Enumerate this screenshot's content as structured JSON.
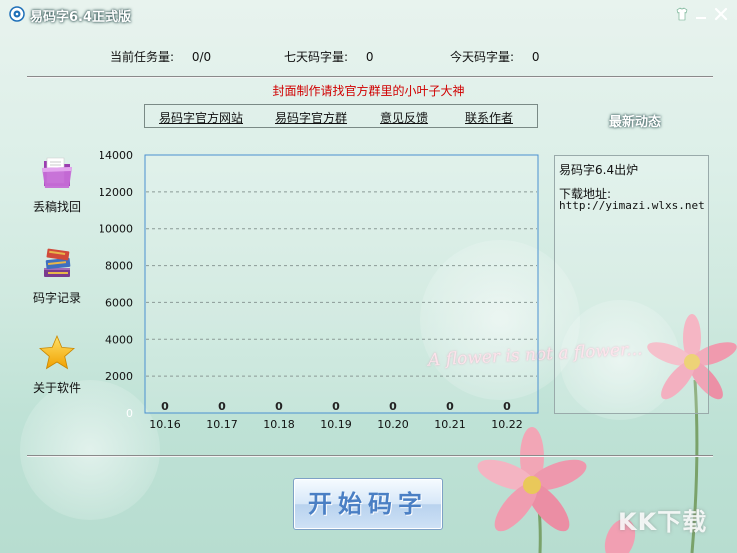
{
  "window": {
    "title": "易码字6.4正式版"
  },
  "stats": {
    "current_tasks_label": "当前任务量:",
    "current_tasks_value": "0/0",
    "seven_day_label": "七天码字量:",
    "seven_day_value": "0",
    "today_label": "今天码字量:",
    "today_value": "0"
  },
  "banner": "封面制作请找官方群里的小叶子大神",
  "links": {
    "site": "易码字官方网站",
    "group": "易码字官方群",
    "feedback": "意见反馈",
    "contact": "联系作者"
  },
  "news": {
    "title": "最新动态",
    "line1": "易码字6.4出炉",
    "line2": "下载地址:",
    "line3": "http://yimazi.wlxs.net"
  },
  "sidebar": {
    "items": [
      {
        "label": "丢稿找回",
        "icon": "folder-icon"
      },
      {
        "label": "码字记录",
        "icon": "books-icon"
      },
      {
        "label": "关于软件",
        "icon": "star-icon"
      }
    ]
  },
  "chart_data": {
    "type": "bar",
    "categories": [
      "10.16",
      "10.17",
      "10.18",
      "10.19",
      "10.20",
      "10.21",
      "10.22"
    ],
    "values": [
      0,
      0,
      0,
      0,
      0,
      0,
      0
    ],
    "ylim": [
      0,
      14000
    ],
    "yticks": [
      0,
      2000,
      4000,
      6000,
      8000,
      10000,
      12000,
      14000
    ],
    "grid": true
  },
  "start_button": "开始码字",
  "decor": {
    "script_text": "A flower is not a flower...",
    "watermark": "KK下载"
  },
  "colors": {
    "banner": "#d00000",
    "chart_border": "#4a90d0",
    "start_text": "#4a7fc4"
  }
}
